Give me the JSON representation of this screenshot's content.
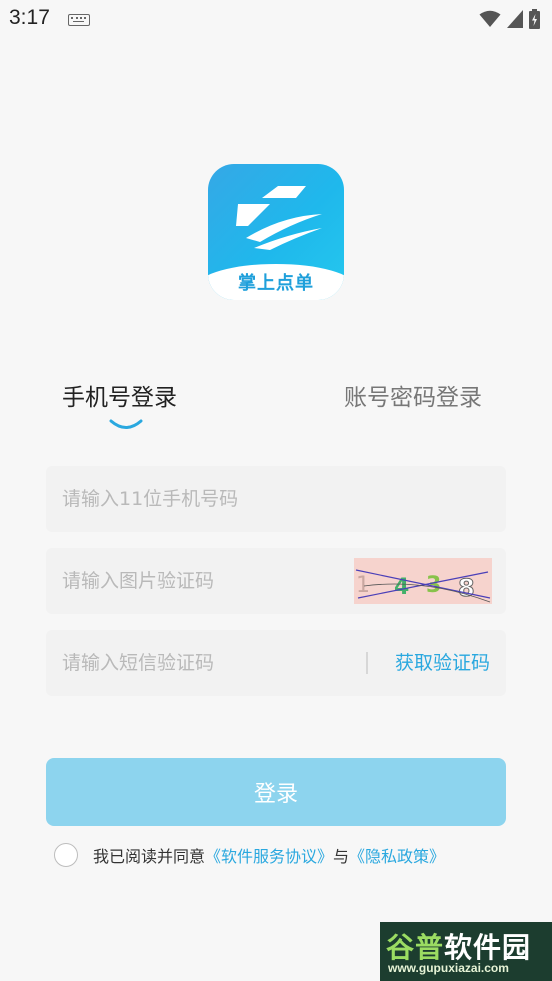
{
  "status_bar": {
    "time": "3:17",
    "icons": [
      "keyboard-icon",
      "wifi-icon",
      "cellular-signal-icon",
      "battery-charging-icon"
    ]
  },
  "logo": {
    "text": "掌上点单"
  },
  "tabs": [
    {
      "label": "手机号登录",
      "active": true
    },
    {
      "label": "账号密码登录",
      "active": false
    }
  ],
  "form": {
    "phone_placeholder": "请输入11位手机号码",
    "image_code_placeholder": "请输入图片验证码",
    "captcha_chars": [
      "1",
      "4",
      "3",
      "8"
    ],
    "sms_code_placeholder": "请输入短信验证码",
    "get_code_label": "获取验证码"
  },
  "login_button": "登录",
  "agreement": {
    "text_before": "我已阅读并同意",
    "service_link": "《软件服务协议》",
    "conjunction": "与",
    "privacy_link": "《隐私政策》"
  },
  "watermark": {
    "part1": "谷普",
    "part2": "软件园",
    "url": "www.gupuxiazai.com"
  },
  "colors": {
    "accent": "#2aa8df",
    "login_button": "#8dd4ee",
    "logo_gradient_start": "#35a8e6",
    "logo_gradient_end": "#25c8ee"
  }
}
